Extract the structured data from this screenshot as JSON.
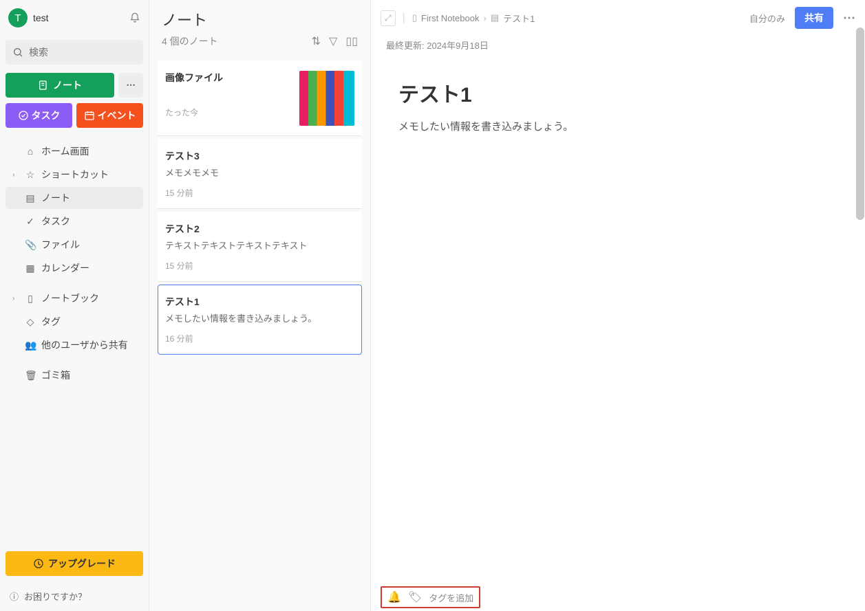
{
  "sidebar": {
    "user_initial": "T",
    "username": "test",
    "search_placeholder": "検索",
    "btn_note": "ノート",
    "btn_task": "タスク",
    "btn_event": "イベント",
    "nav": {
      "home": "ホーム画面",
      "shortcuts": "ショートカット",
      "notes": "ノート",
      "tasks": "タスク",
      "files": "ファイル",
      "calendar": "カレンダー",
      "notebooks": "ノートブック",
      "tags": "タグ",
      "shared": "他のユーザから共有",
      "trash": "ゴミ箱"
    },
    "upgrade": "アップグレード",
    "help": "お困りですか？"
  },
  "note_list": {
    "title": "ノート",
    "count": "4 個のノート",
    "items": [
      {
        "title": "画像ファイル",
        "snippet": "",
        "time": "たった今",
        "has_thumb": true
      },
      {
        "title": "テスト3",
        "snippet": "メモメモメモ",
        "time": "15 分前",
        "has_thumb": false
      },
      {
        "title": "テスト2",
        "snippet": "テキストテキストテキストテキスト",
        "time": "15 分前",
        "has_thumb": false
      },
      {
        "title": "テスト1",
        "snippet": "メモしたい情報を書き込みましょう。",
        "time": "16 分前",
        "has_thumb": false
      }
    ],
    "selected_index": 3
  },
  "editor": {
    "breadcrumb_notebook": "First Notebook",
    "breadcrumb_note": "テスト1",
    "only_me": "自分のみ",
    "share": "共有",
    "last_updated": "最終更新: 2024年9月18日",
    "title": "テスト1",
    "body": "メモしたい情報を書き込みましょう。",
    "add_tag": "タグを追加"
  }
}
